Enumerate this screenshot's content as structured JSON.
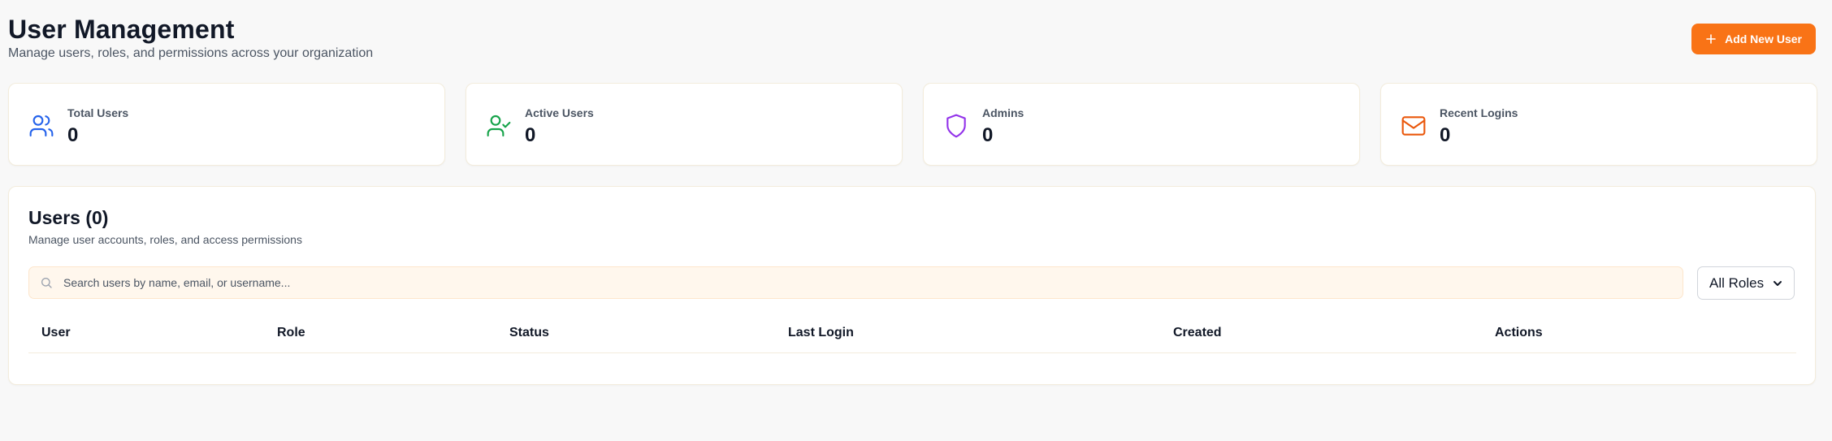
{
  "header": {
    "title": "User Management",
    "subtitle": "Manage users, roles, and permissions across your organization",
    "add_button_label": "Add New User"
  },
  "stats": [
    {
      "label": "Total Users",
      "value": "0",
      "icon": "users-icon",
      "color": "#2563eb"
    },
    {
      "label": "Active Users",
      "value": "0",
      "icon": "user-check-icon",
      "color": "#16a34a"
    },
    {
      "label": "Admins",
      "value": "0",
      "icon": "shield-icon",
      "color": "#9333ea"
    },
    {
      "label": "Recent Logins",
      "value": "0",
      "icon": "mail-icon",
      "color": "#ea580c"
    }
  ],
  "users_panel": {
    "title": "Users (0)",
    "subtitle": "Manage user accounts, roles, and access permissions",
    "search_placeholder": "Search users by name, email, or username...",
    "role_filter_selected": "All Roles",
    "columns": [
      "User",
      "Role",
      "Status",
      "Last Login",
      "Created",
      "Actions"
    ]
  },
  "colors": {
    "accent": "#f97316",
    "page_background": "#f8f8f8",
    "search_background": "#fff7ed"
  }
}
